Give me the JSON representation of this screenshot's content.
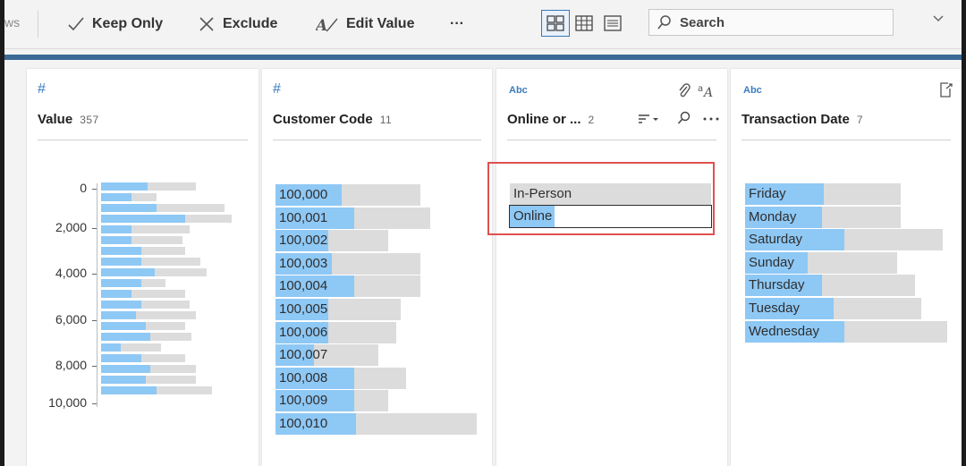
{
  "toolbar": {
    "cut_label": "ws",
    "keep_only_label": "Keep Only",
    "exclude_label": "Exclude",
    "edit_value_label": "Edit Value",
    "more_label": "···",
    "search_placeholder": "Search",
    "accent_color": "#3b6a97"
  },
  "columns": [
    {
      "type_icon": "#",
      "title": "Value",
      "count": "357",
      "histogram": {
        "ticks": [
          "0",
          "2,000",
          "4,000",
          "6,000",
          "8,000",
          "10,000"
        ],
        "bars": [
          {
            "total": 0.63,
            "filled": 0.31
          },
          {
            "total": 0.37,
            "filled": 0.2
          },
          {
            "total": 0.82,
            "filled": 0.37
          },
          {
            "total": 0.87,
            "filled": 0.56
          },
          {
            "total": 0.59,
            "filled": 0.2
          },
          {
            "total": 0.54,
            "filled": 0.2
          },
          {
            "total": 0.56,
            "filled": 0.27
          },
          {
            "total": 0.66,
            "filled": 0.27
          },
          {
            "total": 0.7,
            "filled": 0.36
          },
          {
            "total": 0.43,
            "filled": 0.27
          },
          {
            "total": 0.56,
            "filled": 0.2
          },
          {
            "total": 0.59,
            "filled": 0.27
          },
          {
            "total": 0.63,
            "filled": 0.23
          },
          {
            "total": 0.56,
            "filled": 0.3
          },
          {
            "total": 0.6,
            "filled": 0.33
          },
          {
            "total": 0.4,
            "filled": 0.13
          },
          {
            "total": 0.56,
            "filled": 0.27
          },
          {
            "total": 0.63,
            "filled": 0.33
          },
          {
            "total": 0.63,
            "filled": 0.3
          },
          {
            "total": 0.74,
            "filled": 0.37
          }
        ]
      }
    },
    {
      "type_icon": "#",
      "title": "Customer Code",
      "count": "11",
      "values": [
        {
          "label": "100,000",
          "total": 0.72,
          "filled": 0.33
        },
        {
          "label": "100,001",
          "total": 0.77,
          "filled": 0.39
        },
        {
          "label": "100,002",
          "total": 0.56,
          "filled": 0.26
        },
        {
          "label": "100,003",
          "total": 0.72,
          "filled": 0.28
        },
        {
          "label": "100,004",
          "total": 0.72,
          "filled": 0.39
        },
        {
          "label": "100,005",
          "total": 0.62,
          "filled": 0.26
        },
        {
          "label": "100,006",
          "total": 0.6,
          "filled": 0.26
        },
        {
          "label": "100,007",
          "total": 0.51,
          "filled": 0.19
        },
        {
          "label": "100,008",
          "total": 0.65,
          "filled": 0.39
        },
        {
          "label": "100,009",
          "total": 0.56,
          "filled": 0.39
        },
        {
          "label": "100,010",
          "total": 1.0,
          "filled": 0.4
        }
      ]
    },
    {
      "type_icon": "Abc",
      "title": "Online or ...",
      "count": "2",
      "values": [
        {
          "label": "In-Person",
          "total": 1.0,
          "filled": 0.0
        },
        {
          "label": "Online",
          "total": 1.0,
          "filled": 0.22,
          "selected": true
        }
      ]
    },
    {
      "type_icon": "Abc",
      "title": "Transaction Date",
      "count": "7",
      "values": [
        {
          "label": "Friday",
          "total": 0.77,
          "filled": 0.39
        },
        {
          "label": "Monday",
          "total": 0.77,
          "filled": 0.38
        },
        {
          "label": "Saturday",
          "total": 0.98,
          "filled": 0.49
        },
        {
          "label": "Sunday",
          "total": 0.75,
          "filled": 0.31
        },
        {
          "label": "Thursday",
          "total": 0.84,
          "filled": 0.38
        },
        {
          "label": "Tuesday",
          "total": 0.87,
          "filled": 0.44
        },
        {
          "label": "Wednesday",
          "total": 1.0,
          "filled": 0.49
        }
      ]
    }
  ]
}
